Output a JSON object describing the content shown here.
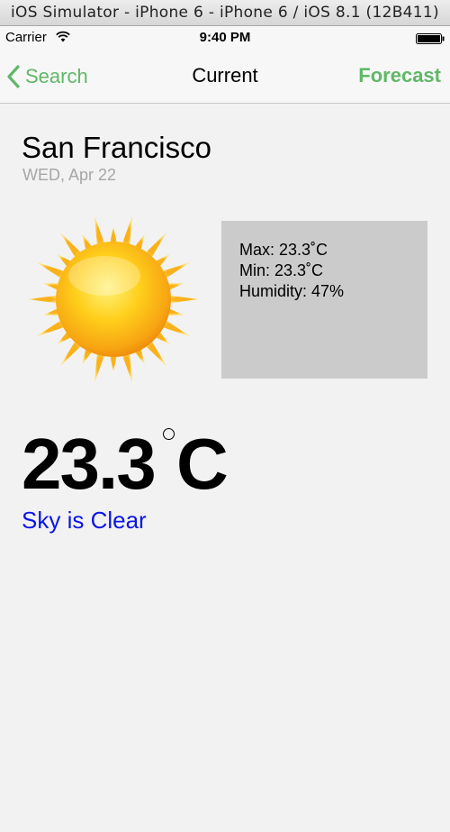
{
  "simulator": {
    "title": "iOS Simulator - iPhone 6 - iPhone 6 / iOS 8.1 (12B411)"
  },
  "status_bar": {
    "carrier": "Carrier",
    "time": "9:40 PM"
  },
  "nav": {
    "back_label": "Search",
    "title": "Current",
    "forecast_label": "Forecast"
  },
  "weather": {
    "city": "San Francisco",
    "date": "WED, Apr 22",
    "max": "Max: 23.3˚C",
    "min": "Min: 23.3˚C",
    "humidity": "Humidity: 47%",
    "temp_value": "23.3",
    "temp_unit": "C",
    "condition": "Sky is Clear"
  },
  "colors": {
    "accent_green": "#5fb866",
    "condition_blue": "#0a16e6",
    "stats_bg": "#cbcbcb"
  },
  "icons": {
    "weather_icon": "sun-icon"
  }
}
